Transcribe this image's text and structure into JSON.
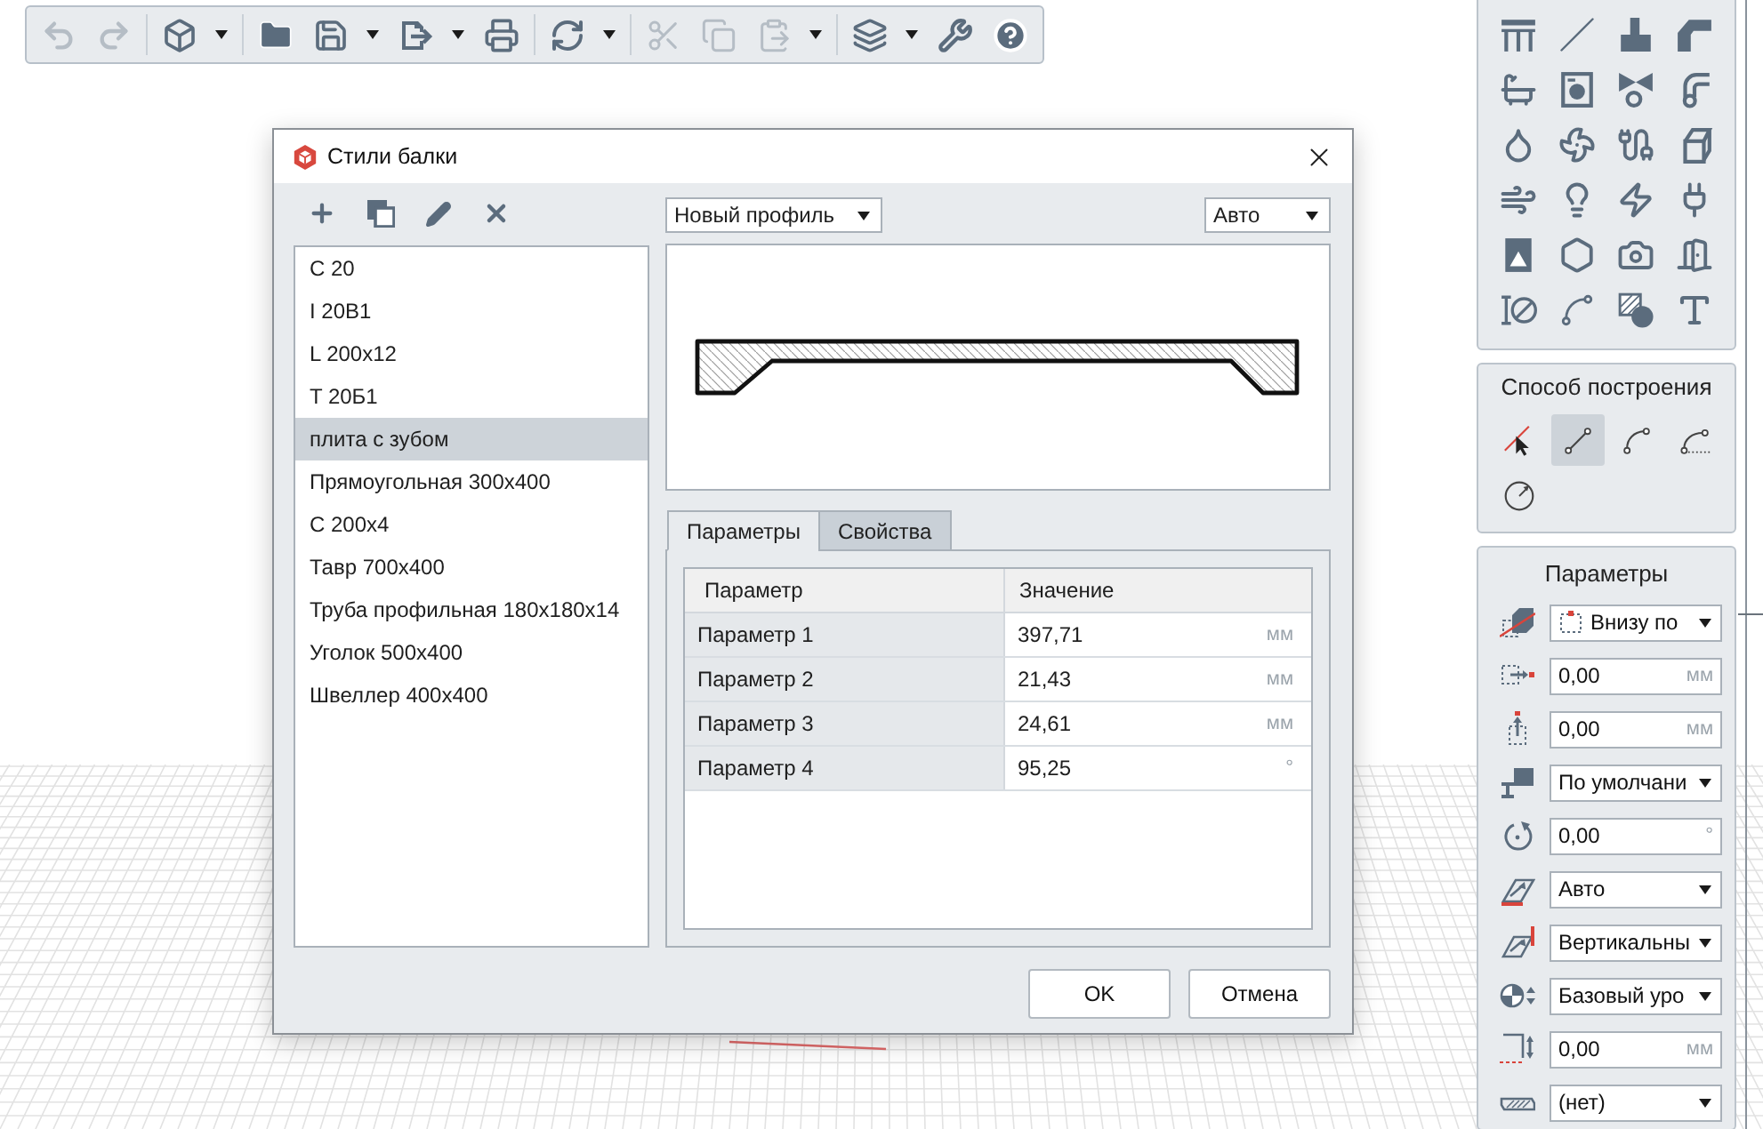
{
  "toolbar": {
    "groups": [
      [
        {
          "disabled": true,
          "dropdown": false
        },
        {
          "disabled": true,
          "dropdown": false
        }
      ],
      [
        {
          "disabled": false,
          "dropdown": true
        }
      ],
      [
        {
          "disabled": false,
          "dropdown": false
        },
        {
          "disabled": false,
          "dropdown": true
        },
        {
          "disabled": false,
          "dropdown": true
        },
        {
          "disabled": false,
          "dropdown": false
        }
      ],
      [
        {
          "disabled": false,
          "dropdown": true
        }
      ],
      [
        {
          "disabled": true,
          "dropdown": false
        },
        {
          "disabled": true,
          "dropdown": false
        },
        {
          "disabled": true,
          "dropdown": true
        }
      ],
      [
        {
          "disabled": false,
          "dropdown": true
        },
        {
          "disabled": false,
          "dropdown": false
        },
        {
          "disabled": false,
          "dropdown": false
        }
      ]
    ]
  },
  "dialog": {
    "title": "Стили балки",
    "list": [
      {
        "label": "С 20",
        "selected": false
      },
      {
        "label": "I 20В1",
        "selected": false
      },
      {
        "label": "L 200x12",
        "selected": false
      },
      {
        "label": "T 20Б1",
        "selected": false
      },
      {
        "label": "плита с зубом",
        "selected": true
      },
      {
        "label": "Прямоугольная 300x400",
        "selected": false
      },
      {
        "label": "С 200x4",
        "selected": false
      },
      {
        "label": "Тавр 700x400",
        "selected": false
      },
      {
        "label": "Труба профильная 180x180x14",
        "selected": false
      },
      {
        "label": "Уголок 500x400",
        "selected": false
      },
      {
        "label": "Швеллер 400x400",
        "selected": false
      }
    ],
    "profile_select": {
      "value": "Новый профиль"
    },
    "scale_select": {
      "value": "Авто"
    },
    "tabs": [
      {
        "label": "Параметры",
        "selected": true
      },
      {
        "label": "Свойства",
        "selected": false
      }
    ],
    "table": {
      "columns": [
        "Параметр",
        "Значение"
      ],
      "rows": [
        {
          "name": "Параметр 1",
          "value": "397,71",
          "unit": "мм"
        },
        {
          "name": "Параметр 2",
          "value": "21,43",
          "unit": "мм"
        },
        {
          "name": "Параметр 3",
          "value": "24,61",
          "unit": "мм"
        },
        {
          "name": "Параметр 4",
          "value": "95,25",
          "unit": "°"
        }
      ]
    },
    "buttons": [
      "OK",
      "Отмена"
    ]
  },
  "construction_panel": {
    "title": "Способ построения",
    "methods": [
      {
        "selected": false
      },
      {
        "selected": true
      },
      {
        "selected": false
      },
      {
        "selected": false
      },
      {
        "selected": false
      }
    ]
  },
  "parameters_panel": {
    "title": "Параметры",
    "rows": [
      {
        "kind": "select",
        "value": "Внизу по"
      },
      {
        "kind": "input",
        "value": "0,00",
        "unit": "мм"
      },
      {
        "kind": "input",
        "value": "0,00",
        "unit": "мм"
      },
      {
        "kind": "select",
        "value": "По умолчани"
      },
      {
        "kind": "input",
        "value": "0,00",
        "unit": "°"
      },
      {
        "kind": "select",
        "value": "Авто"
      },
      {
        "kind": "select",
        "value": "Вертикальны"
      },
      {
        "kind": "select",
        "value": "Базовый уро"
      },
      {
        "kind": "input",
        "value": "0,00",
        "unit": "мм"
      },
      {
        "kind": "select",
        "value": "(нет)"
      }
    ]
  }
}
